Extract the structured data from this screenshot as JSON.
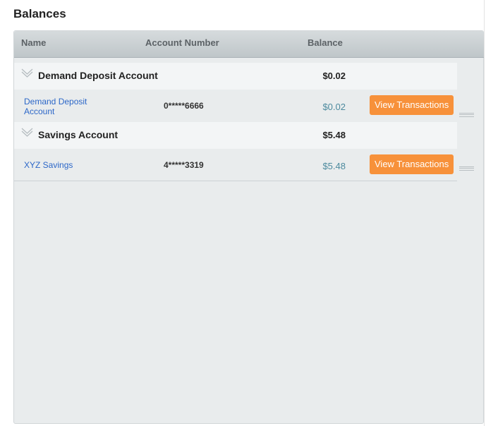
{
  "page": {
    "title": "Balances"
  },
  "table": {
    "headers": {
      "name": "Name",
      "account_number": "Account Number",
      "balance": "Balance"
    },
    "groups": [
      {
        "name": "Demand Deposit Account",
        "total": "$0.02",
        "accounts": [
          {
            "name": "Demand Deposit Account",
            "number": "0*****6666",
            "balance": "$0.02",
            "action": "View Transactions"
          }
        ]
      },
      {
        "name": "Savings Account",
        "total": "$5.48",
        "accounts": [
          {
            "name": "XYZ Savings",
            "number": "4*****3319",
            "balance": "$5.48",
            "action": "View Transactions"
          }
        ]
      }
    ]
  },
  "colors": {
    "action_button": "#f7913a",
    "link": "#2c67c8",
    "balance_value": "#4c8a9e"
  },
  "icons": {
    "group_toggle": "chevron-down-icon",
    "row_handle": "drag-handle-icon"
  }
}
